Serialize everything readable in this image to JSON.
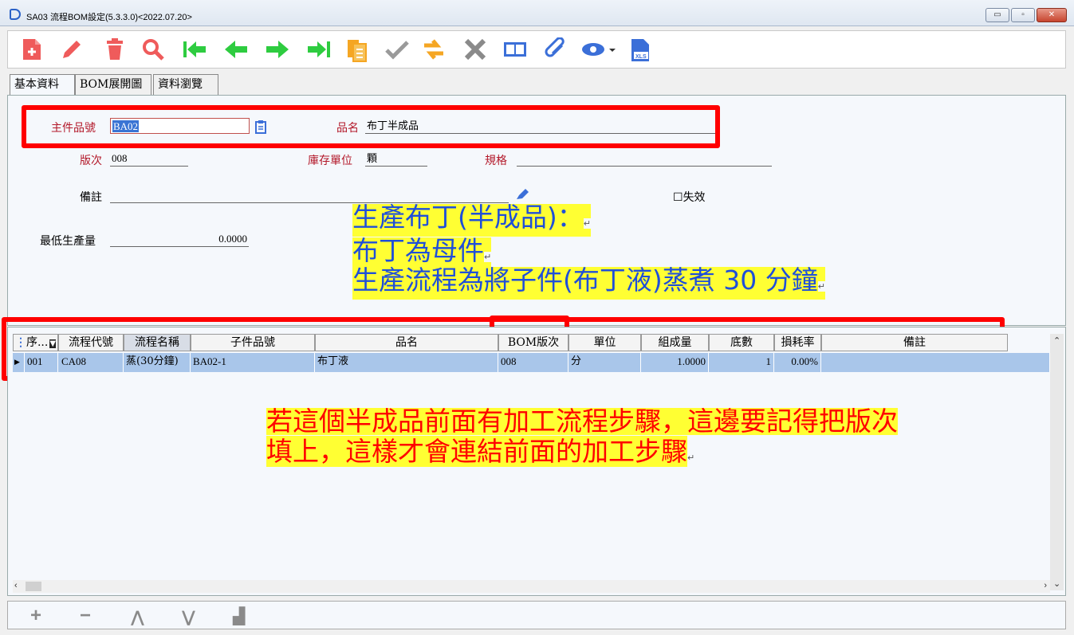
{
  "window": {
    "title": "SA03 流程BOM設定(5.3.3.0)<2022.07.20>",
    "minimize_label": "▭",
    "maximize_label": "▫",
    "close_label": "✕"
  },
  "toolbar": {
    "icons": [
      "new-icon",
      "edit-icon",
      "delete-icon",
      "search-icon",
      "first-record-icon",
      "previous-record-icon",
      "next-record-icon",
      "last-record-icon",
      "copy-icon",
      "confirm-icon",
      "refresh-icon",
      "cancel-icon",
      "book-icon",
      "attachment-icon",
      "view-icon",
      "excel-export-icon"
    ]
  },
  "tabs": [
    {
      "label": "基本資料"
    },
    {
      "label": "BOM展開圖"
    },
    {
      "label": "資料瀏覽"
    }
  ],
  "form": {
    "main_part_label": "主件品號",
    "main_part_value": "BA02",
    "product_name_label": "品名",
    "product_name_value": "布丁半成品",
    "version_label": "版次",
    "version_value": "008",
    "unit_label": "庫存單位",
    "unit_value": "顆",
    "spec_label": "規格",
    "spec_value": "",
    "remark_label": "備註",
    "remark_value": "",
    "invalid_label": "失效",
    "min_qty_label": "最低生產量",
    "min_qty_value": "0.0000"
  },
  "annotations": {
    "note1_line1": "生產布丁(半成品)：",
    "note1_line2": "布丁為母件",
    "note1_line3": "生產流程為將子件(布丁液)蒸煮 30 分鐘",
    "note2_line1": "若這個半成品前面有加工流程步驟，這邊要記得把版次",
    "note2_line2": "填上，這樣才會連結前面的加工步驟",
    "para_mark": "↵",
    "colors": {
      "highlight": "#ffff33",
      "note1_text": "#1f4fd9",
      "note2_text": "#ff0000",
      "box": "#ff0000"
    }
  },
  "grid": {
    "columns": [
      "序...",
      "流程代號",
      "流程名稱",
      "子件品號",
      "品名",
      "BOM版次",
      "單位",
      "組成量",
      "底數",
      "損耗率",
      "備註"
    ],
    "rows": [
      {
        "seq": "001",
        "process_code": "CA08",
        "process_name": "蒸(30分鐘)",
        "child_part": "BA02-1",
        "name": "布丁液",
        "bom_version": "008",
        "unit": "分",
        "qty": "1.0000",
        "base": "1",
        "loss_rate": "0.00%",
        "remark": ""
      }
    ]
  },
  "bottom_toolbar": {
    "add": "+",
    "remove": "−",
    "up": "⋀",
    "down": "⋁",
    "tree": "▟"
  }
}
